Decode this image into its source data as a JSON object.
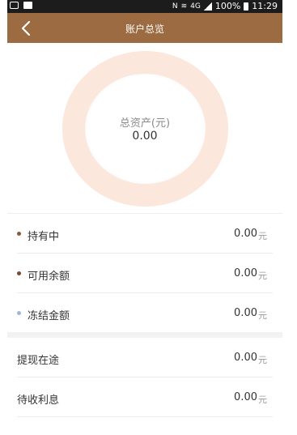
{
  "status_bar": {
    "network_label": "4G",
    "battery_percent": "100%",
    "time": "11:29"
  },
  "header": {
    "title": "账户总览"
  },
  "summary": {
    "total_label": "总资产(元)",
    "total_value": "0.00"
  },
  "colors": {
    "header_bg": "#9c6b41",
    "ring": "#fbe7db",
    "dot_holding": "#8a5a3c",
    "dot_available": "#7a4a34",
    "dot_frozen": "#9fb8d6"
  },
  "holdings": [
    {
      "label": "持有中",
      "value": "0.00",
      "unit": "元",
      "dot_color": "#8a5a3c"
    },
    {
      "label": "可用余额",
      "value": "0.00",
      "unit": "元",
      "dot_color": "#7a4a34"
    },
    {
      "label": "冻结金额",
      "value": "0.00",
      "unit": "元",
      "dot_color": "#9fb8d6"
    }
  ],
  "others": [
    {
      "label": "提现在途",
      "value": "0.00",
      "unit": "元"
    },
    {
      "label": "待收利息",
      "value": "0.00",
      "unit": "元"
    }
  ]
}
